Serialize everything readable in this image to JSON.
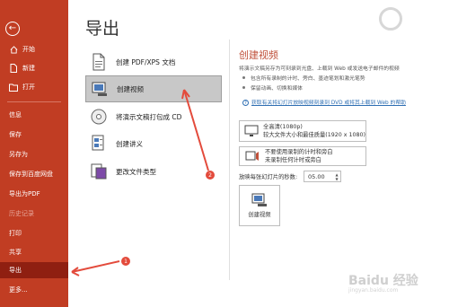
{
  "sidebar": {
    "back_icon": "back-arrow-icon",
    "top_items": [
      {
        "label": "开始",
        "icon": "home-icon"
      },
      {
        "label": "新建",
        "icon": "new-document-icon"
      },
      {
        "label": "打开",
        "icon": "folder-open-icon"
      }
    ],
    "items": [
      {
        "label": "信息",
        "state": "normal"
      },
      {
        "label": "保存",
        "state": "normal"
      },
      {
        "label": "另存为",
        "state": "normal"
      },
      {
        "label": "保存到百度网盘",
        "state": "normal"
      },
      {
        "label": "导出为PDF",
        "state": "normal"
      },
      {
        "label": "历史记录",
        "state": "disabled"
      },
      {
        "label": "打印",
        "state": "normal"
      },
      {
        "label": "共享",
        "state": "normal"
      },
      {
        "label": "导出",
        "state": "active"
      },
      {
        "label": "更多...",
        "state": "normal"
      }
    ],
    "colors": {
      "background": "#c13d23",
      "active": "#8f1f11"
    }
  },
  "export": {
    "title": "导出",
    "options": [
      {
        "label": "创建 PDF/XPS 文档",
        "icon": "pdf-document-icon",
        "selected": false
      },
      {
        "label": "创建视频",
        "icon": "video-icon",
        "selected": true
      },
      {
        "label": "将演示文稿打包成 CD",
        "icon": "cd-disc-icon",
        "selected": false
      },
      {
        "label": "创建讲义",
        "icon": "handout-icon",
        "selected": false
      },
      {
        "label": "更改文件类型",
        "icon": "file-type-icon",
        "selected": false
      }
    ]
  },
  "video_panel": {
    "title": "创建视频",
    "description": "将演示文稿另存为可刻录到光盘、上载到 Web 或发送电子邮件的视频",
    "bullets": [
      "包含所有录制的计时、旁白、墨迹笔划和激光笔势",
      "保留动画、切换和媒体"
    ],
    "help_link": "获取有关将幻灯片放映视频刻录到 DVD 或将其上载到 Web 的帮助",
    "quality": {
      "line1": "全高清(1080p)",
      "line2": "较大文件大小和最佳质量(1920 x 1080)"
    },
    "narration": {
      "line1": "不要使用录制的计时和旁白",
      "line2": "未录制任何计时或旁白"
    },
    "seconds_label": "放映每张幻灯片的秒数:",
    "seconds_value": "05.00",
    "create_button": "创建视频",
    "accent_color": "#c0503a"
  },
  "annotations": {
    "marker_1": "1",
    "marker_2": "2",
    "arrow_color": "#e34b3c"
  },
  "watermark": {
    "text": "Baidu 经验",
    "sub": "jingyan.baidu.com"
  }
}
